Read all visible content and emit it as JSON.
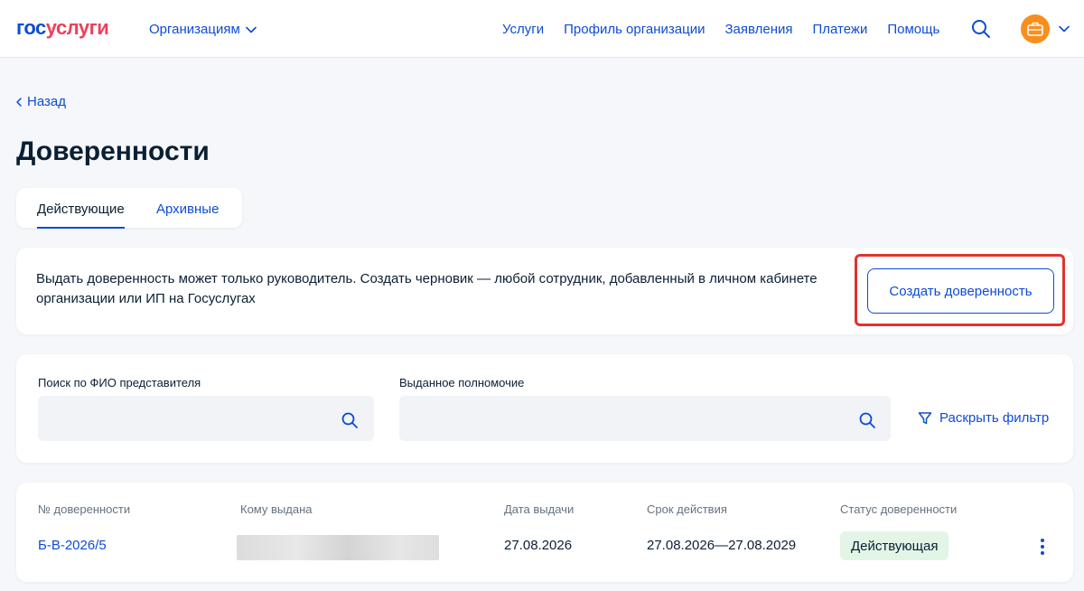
{
  "header": {
    "logo_part1": "гос",
    "logo_part2": "услуги",
    "org_switch_label": "Организациям",
    "nav": [
      "Услуги",
      "Профиль организации",
      "Заявления",
      "Платежи",
      "Помощь"
    ]
  },
  "page": {
    "back_label": "Назад",
    "title": "Доверенности",
    "tabs": [
      {
        "label": "Действующие",
        "active": true
      },
      {
        "label": "Архивные",
        "active": false
      }
    ]
  },
  "notice": {
    "text": "Выдать доверенность может только руководитель. Создать черновик — любой сотрудник, добавленный в личном кабинете организации или ИП на Госуслугах",
    "create_button_label": "Создать доверенность"
  },
  "filter": {
    "name_search_label": "Поиск по ФИО представителя",
    "name_search_value": "",
    "authority_label": "Выданное полномочие",
    "authority_value": "",
    "expand_filter_label": "Раскрыть фильтр"
  },
  "table": {
    "columns": [
      "№ доверенности",
      "Кому выдана",
      "Дата выдачи",
      "Срок действия",
      "Статус доверенности"
    ],
    "rows": [
      {
        "number": "Б-В-2026/5",
        "issued_to": "",
        "issue_date": "27.08.2026",
        "validity": "27.08.2026—27.08.2029",
        "status": "Действующая"
      }
    ]
  },
  "colors": {
    "brand_blue": "#0d4cd3",
    "brand_red": "#ee3f58",
    "highlight_red": "#e0332d",
    "status_green_bg": "#e2f5e6",
    "avatar_orange": "#f98e1b"
  },
  "icons": {
    "org_switch": "chevron-down-icon",
    "search": "search-icon",
    "avatar": "briefcase-icon",
    "back": "chevron-left-icon",
    "filter": "funnel-icon",
    "row_menu": "kebab-menu-icon"
  }
}
